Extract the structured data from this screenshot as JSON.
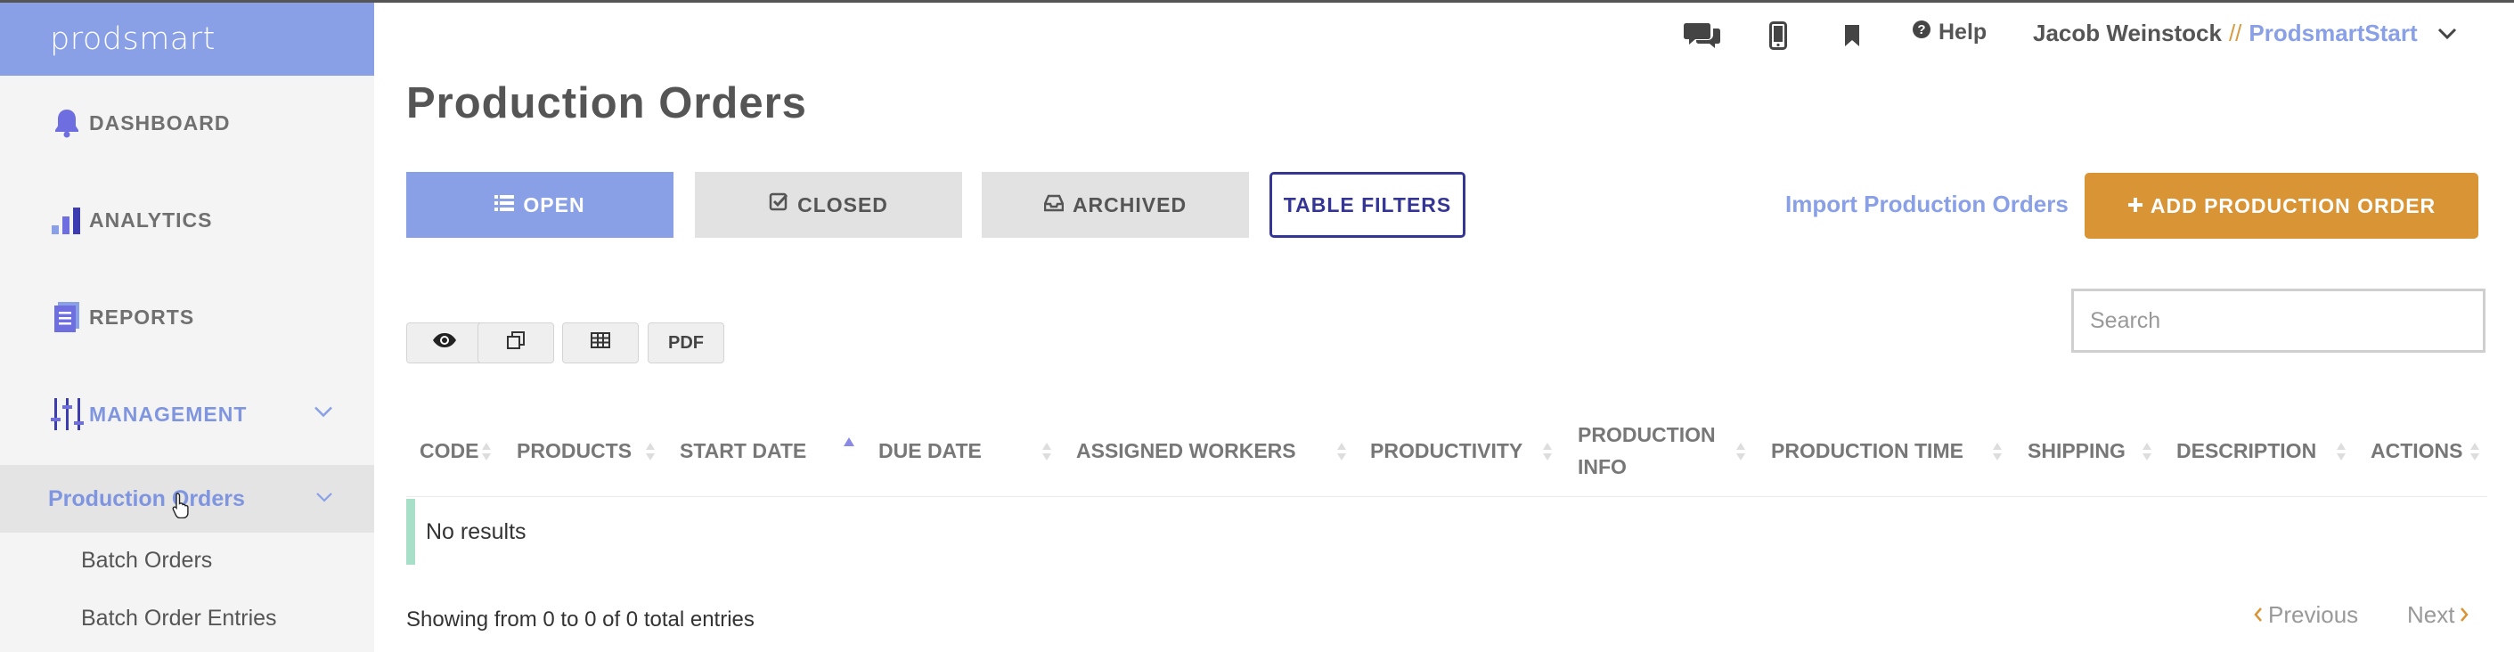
{
  "app": {
    "brand": "prodsmart"
  },
  "sidebar": {
    "items": [
      {
        "label": "DASHBOARD",
        "icon": "bell-icon"
      },
      {
        "label": "ANALYTICS",
        "icon": "bar-chart-icon"
      },
      {
        "label": "REPORTS",
        "icon": "document-icon"
      },
      {
        "label": "MANAGEMENT",
        "icon": "sliders-icon"
      }
    ],
    "active_sub": "Production Orders",
    "sub_items": [
      "Batch Orders",
      "Batch Order Entries"
    ]
  },
  "header": {
    "help": "Help",
    "user_name": "Jacob Weinstock",
    "separator": "//",
    "company": "ProdsmartStart"
  },
  "page": {
    "title": "Production Orders"
  },
  "tabs": {
    "open": "OPEN",
    "closed": "CLOSED",
    "archived": "ARCHIVED",
    "filters": "TABLE FILTERS"
  },
  "actions": {
    "import": "Import Production Orders",
    "add": "ADD PRODUCTION ORDER"
  },
  "export": {
    "pdf": "PDF"
  },
  "search": {
    "placeholder": "Search",
    "value": ""
  },
  "table": {
    "columns": [
      "CODE",
      "PRODUCTS",
      "START DATE",
      "DUE DATE",
      "ASSIGNED WORKERS",
      "PRODUCTIVITY",
      "PRODUCTION INFO",
      "PRODUCTION TIME",
      "SHIPPING",
      "DESCRIPTION",
      "ACTIONS"
    ],
    "sorted_column": "START DATE",
    "sort_direction": "ascending",
    "empty_text": "No results",
    "summary": "Showing from 0 to 0 of 0 total entries"
  },
  "pagination": {
    "previous": "Previous",
    "next": "Next"
  },
  "colors": {
    "brand": "#8aa0e6",
    "accent": "#d99436",
    "filters_border": "#353595",
    "empty_marker": "#a8dfc9"
  }
}
